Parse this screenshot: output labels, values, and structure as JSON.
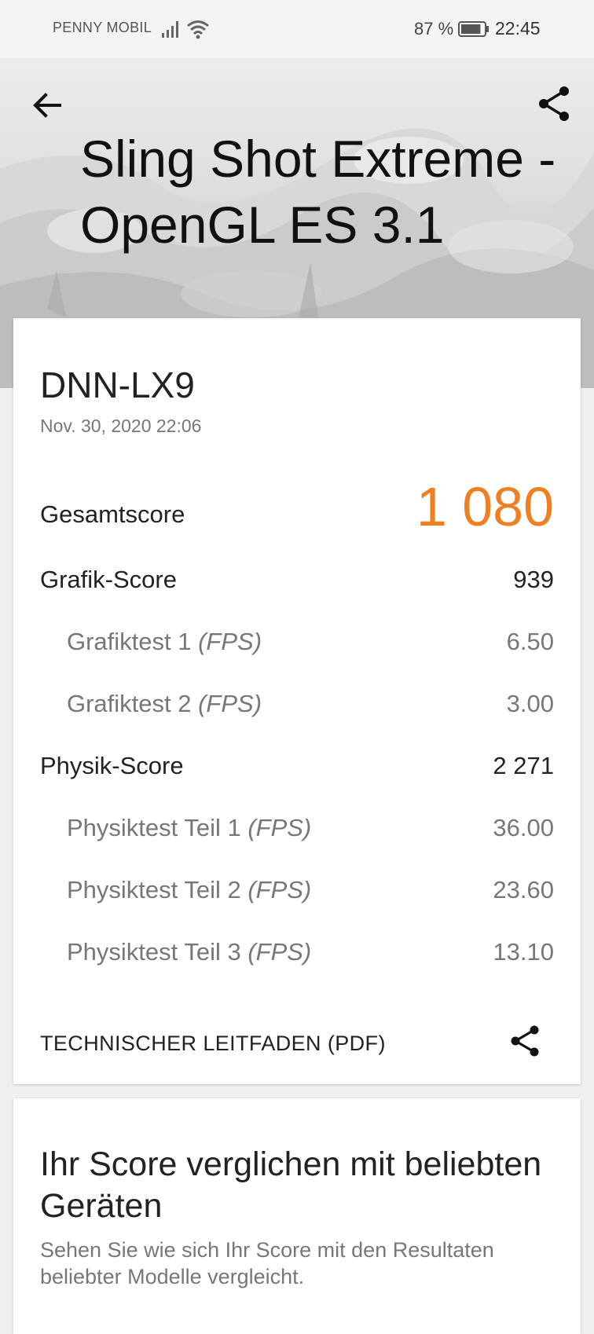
{
  "status_bar": {
    "carrier": "PENNY MOBIL",
    "battery_percent": "87 %",
    "time": "22:45",
    "battery_level": 0.87,
    "icons": [
      "signal-icon",
      "wifi-icon",
      "battery-icon"
    ]
  },
  "header": {
    "title": "Sling Shot Extreme - OpenGL ES 3.1",
    "back_icon": "arrow-left-icon",
    "share_icon": "share-icon"
  },
  "result": {
    "device": "DNN-LX9",
    "date": "Nov. 30, 2020 22:06",
    "total_label": "Gesamtscore",
    "total_value": "1 080",
    "graphics_label": "Grafik-Score",
    "graphics_value": "939",
    "graphics_test1_label": "Grafiktest 1 ",
    "graphics_test1_value": "6.50",
    "graphics_test2_label": "Grafiktest 2 ",
    "graphics_test2_value": "3.00",
    "physics_label": "Physik-Score",
    "physics_value": "2 271",
    "physics_part1_label": "Physiktest Teil 1 ",
    "physics_part1_value": "36.00",
    "physics_part2_label": "Physiktest Teil 2 ",
    "physics_part2_value": "23.60",
    "physics_part3_label": "Physiktest Teil 3 ",
    "physics_part3_value": "13.10",
    "fps_unit": "(FPS)",
    "pdf_link": "TECHNISCHER LEITFADEN (PDF)",
    "accent_color": "#f07f22"
  },
  "comparison": {
    "title": "Ihr Score verglichen mit beliebten Geräten",
    "description": "Sehen Sie wie sich Ihr Score mit den Resultaten beliebter Modelle vergleicht."
  }
}
